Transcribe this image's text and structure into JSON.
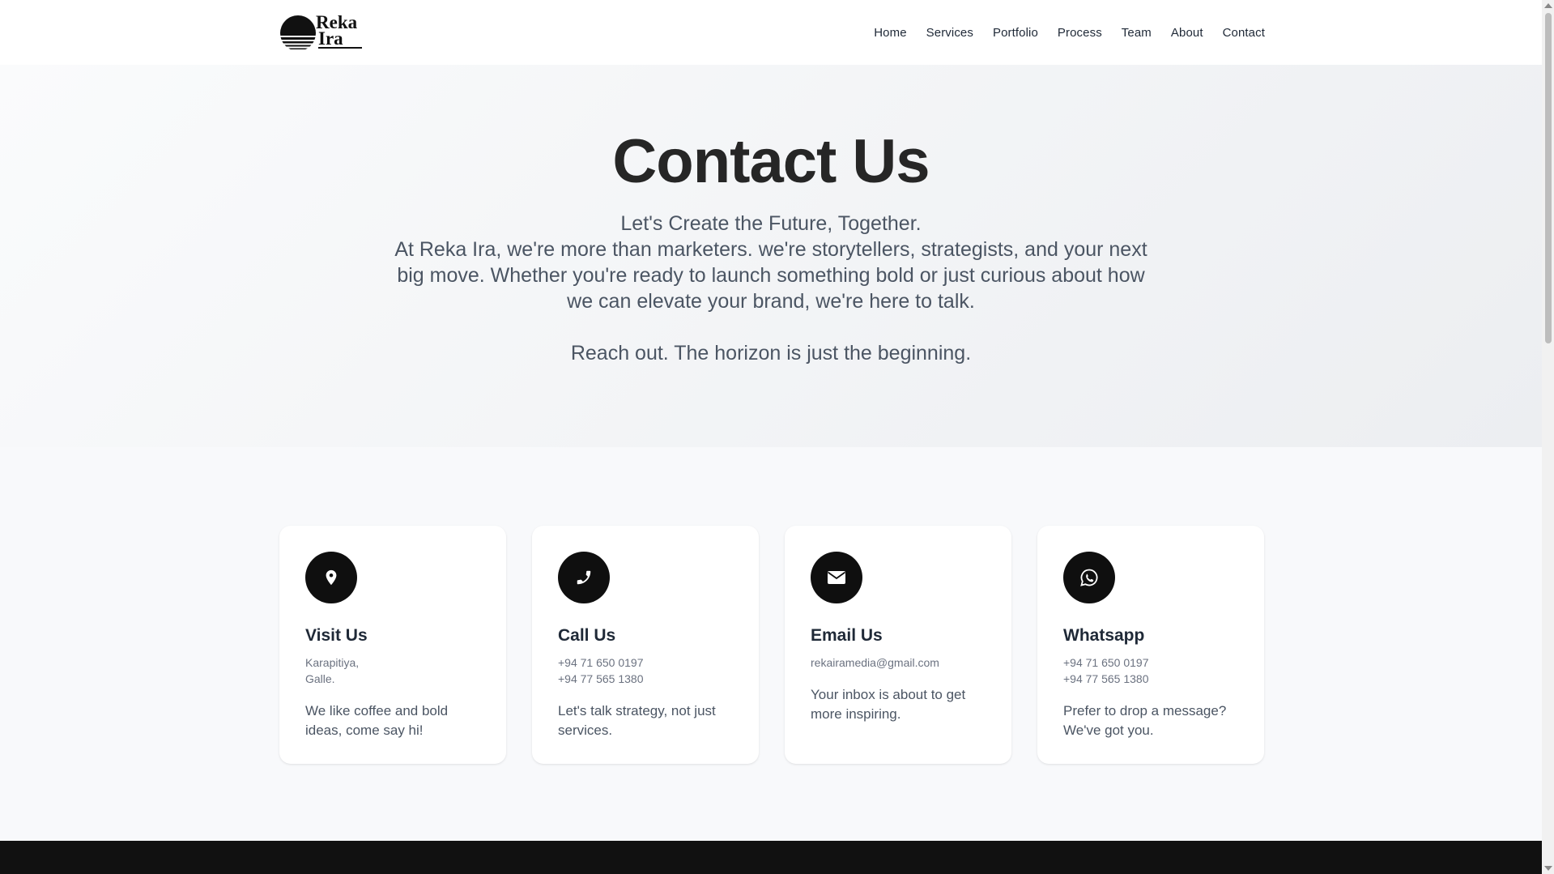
{
  "brand": {
    "line1": "Reka",
    "line2": "Ira",
    "logo_icon": "sunset-stripes-icon"
  },
  "nav": {
    "items": [
      {
        "label": "Home"
      },
      {
        "label": "Services"
      },
      {
        "label": "Portfolio"
      },
      {
        "label": "Process"
      },
      {
        "label": "Team"
      },
      {
        "label": "About"
      },
      {
        "label": "Contact"
      }
    ]
  },
  "hero": {
    "title": "Contact Us",
    "tagline": "Let's Create the Future, Together.",
    "body": "At Reka Ira, we're more than marketers. we're storytellers, strategists, and your next big move. Whether you're ready to launch something bold or just curious about how we can elevate your brand, we're here to talk.",
    "closing": "Reach out. The horizon is just the beginning."
  },
  "cards": [
    {
      "icon": "map-pin-icon",
      "title": "Visit Us",
      "lines": [
        "Karapitiya,",
        "Galle."
      ],
      "description": "We like coffee and bold ideas, come say hi!"
    },
    {
      "icon": "phone-icon",
      "title": "Call Us",
      "lines": [
        "+94 71 650 0197",
        "+94 77 565 1380"
      ],
      "description": "Let's talk strategy, not just services."
    },
    {
      "icon": "envelope-icon",
      "title": "Email Us",
      "lines": [
        "rekairamedia@gmail.com"
      ],
      "description": "Your inbox is about to get more inspiring."
    },
    {
      "icon": "whatsapp-icon",
      "title": "Whatsapp",
      "lines": [
        "+94 71 650 0197",
        "+94 77 565 1380"
      ],
      "description": "Prefer to drop a message? We've got you."
    }
  ],
  "colors": {
    "accent": "#0f0f0f",
    "background": "#f8f9fb",
    "footer": "#111111"
  }
}
